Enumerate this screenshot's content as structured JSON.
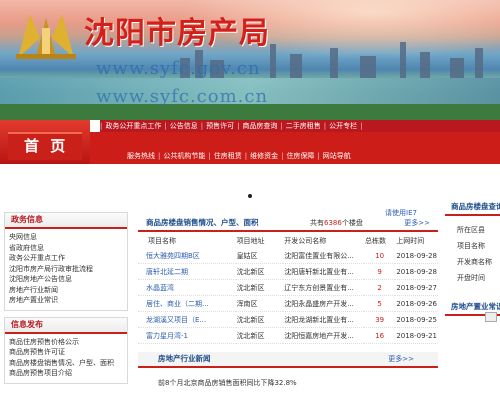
{
  "header": {
    "site_title": "沈阳市房产局",
    "url1": "www.syfc.gov.cn",
    "url2": "www.syfc.com.cn"
  },
  "marquee": {
    "items": [
      "政务公开重点工作",
      "公告信息",
      "预售许可",
      "商品房查询",
      "二手房租售",
      "公开专栏"
    ]
  },
  "nav": {
    "home_label": "首 页",
    "items": [
      "服务热线",
      "公共机构节能",
      "住房租赁",
      "维修资金",
      "住房保障",
      "网站导航"
    ]
  },
  "notice": "请使用IE7",
  "left": {
    "gov_info": {
      "title": "政务信息",
      "items": [
        "央网信息",
        "省政府信息",
        "政务公开重点工作",
        "沈阳市房产局行政审批流程",
        "沈阳房地产公告信息",
        "房地产行业新闻",
        "房地产置业常识"
      ]
    },
    "info_release": {
      "title": "信息发布",
      "items": [
        "商品住房预售价格公示",
        "商品房预售许可证",
        "商品房楼盘销售情况、户型、面积",
        "商品房预售项目介绍"
      ]
    }
  },
  "sales": {
    "title": "商品房楼盘销售情况、户型、面积",
    "count_prefix": "共有",
    "count_value": "6386",
    "count_suffix": "个楼盘",
    "more": "更多>>",
    "columns": [
      "项目名称",
      "项目地址",
      "开发公司名称",
      "总栋数",
      "上网时间"
    ],
    "rows": [
      {
        "name": "恒大雅苑四期B区",
        "addr": "皇姑区",
        "company": "沈阳富佳置业有限公...",
        "count": "10",
        "date": "2018-09-28"
      },
      {
        "name": "唐轩北延二期",
        "addr": "沈北新区",
        "company": "沈阳唐轩新北置业有...",
        "count": "9",
        "date": "2018-09-28"
      },
      {
        "name": "水晶蓝湾",
        "addr": "沈北新区",
        "company": "辽宁东方创景置业有...",
        "count": "2",
        "date": "2018-09-27"
      },
      {
        "name": "居住、商业（二期...",
        "addr": "浑南区",
        "company": "沈阳永晶盛房产开发...",
        "count": "5",
        "date": "2018-09-26"
      },
      {
        "name": "龙湖溪又项目（E...",
        "addr": "沈北新区",
        "company": "沈阳龙湖新北置业有...",
        "count": "39",
        "date": "2018-09-25"
      },
      {
        "name": "富力星月湾-1",
        "addr": "沈北新区",
        "company": "沈阳恒嘉房地产开发...",
        "count": "16",
        "date": "2018-09-21"
      }
    ]
  },
  "news": {
    "title": "房地产行业新闻",
    "more": "更多>>",
    "items": [
      "前8个月北京商品房销售面积同比下降32.8%"
    ]
  },
  "right": {
    "search_title": "商品房楼盘查询",
    "fields": [
      "所在区县",
      "项目名称",
      "开发商名称",
      "开盘时间"
    ],
    "knowledge_title": "房地产置业常识"
  }
}
